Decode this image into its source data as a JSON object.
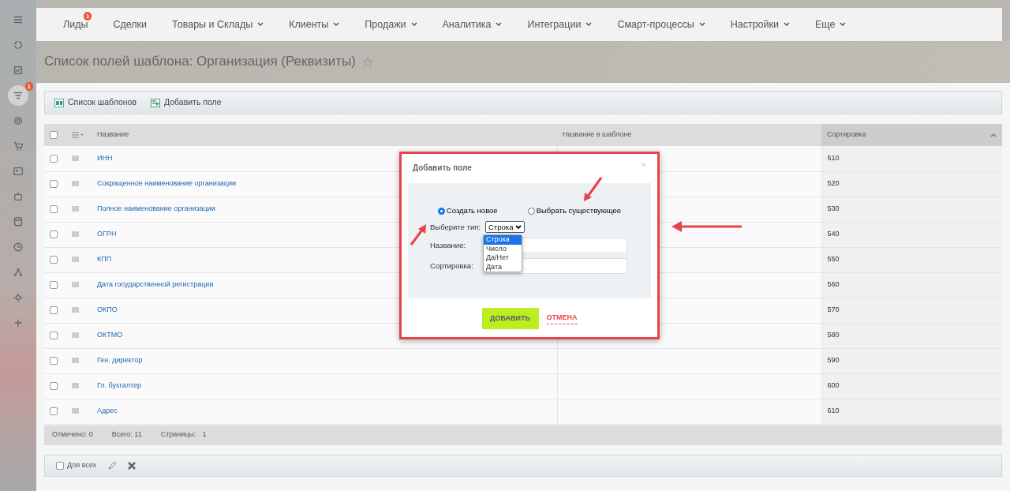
{
  "sidebar": {
    "items": [
      {
        "selected": false
      },
      {
        "selected": false
      },
      {
        "selected": false
      },
      {
        "selected": true,
        "badge": "1"
      },
      {
        "selected": false
      },
      {
        "selected": false
      },
      {
        "selected": false
      },
      {
        "selected": false
      },
      {
        "selected": false
      },
      {
        "selected": false
      },
      {
        "selected": false
      },
      {
        "selected": false
      },
      {
        "selected": false
      }
    ]
  },
  "nav": [
    {
      "label": "Лиды",
      "badge": "1",
      "dropdown": false
    },
    {
      "label": "Сделки",
      "dropdown": false
    },
    {
      "label": "Товары и Склады",
      "dropdown": true
    },
    {
      "label": "Клиенты",
      "dropdown": true
    },
    {
      "label": "Продажи",
      "dropdown": true
    },
    {
      "label": "Аналитика",
      "dropdown": true
    },
    {
      "label": "Интеграции",
      "dropdown": true
    },
    {
      "label": "Смарт-процессы",
      "dropdown": true
    },
    {
      "label": "Настройки",
      "dropdown": true
    },
    {
      "label": "Еще",
      "dropdown": true
    }
  ],
  "page_title": "Список полей шаблона: Организация (Реквизиты)",
  "favorite": false,
  "toolbar": [
    {
      "label": "Список шаблонов",
      "kind": "list"
    },
    {
      "label": "Добавить поле",
      "kind": "add"
    }
  ],
  "table": {
    "all_checked": false,
    "columns": [
      {
        "label": "Название",
        "sorted": false
      },
      {
        "label": "Название в шаблоне",
        "sorted": false
      },
      {
        "label": "Сортировка",
        "sorted": true
      }
    ],
    "rows": [
      {
        "name": "ИНН",
        "sort": "510",
        "checked": false
      },
      {
        "name": "Сокращенное наименование организации",
        "sort": "520",
        "checked": false
      },
      {
        "name": "Полное наименование организации",
        "sort": "530",
        "checked": false
      },
      {
        "name": "ОГРН",
        "sort": "540",
        "checked": false
      },
      {
        "name": "КПП",
        "sort": "550",
        "checked": false
      },
      {
        "name": "Дата государственной регистрации",
        "sort": "560",
        "checked": false
      },
      {
        "name": "ОКПО",
        "sort": "570",
        "checked": false
      },
      {
        "name": "ОКТМО",
        "sort": "580",
        "checked": false
      },
      {
        "name": "Ген. директор",
        "sort": "590",
        "checked": false
      },
      {
        "name": "Гл. бухгалтер",
        "sort": "600",
        "checked": false
      },
      {
        "name": "Адрес",
        "sort": "610",
        "checked": false
      }
    ]
  },
  "footer": {
    "marked": "Отмечено: 0",
    "total": "Всего: 11",
    "pages_label": "Страницы:",
    "page": "1"
  },
  "actions": {
    "for_all": {
      "label": "Для всех",
      "checked": false
    }
  },
  "dialog": {
    "title": "Добавить поле",
    "modes": [
      {
        "label": "Создать новое",
        "selected": true
      },
      {
        "label": "Выбрать существующее",
        "selected": false
      }
    ],
    "type_label": "Выберите тип:",
    "type_value": "Строка",
    "type_options": [
      {
        "label": "Строка",
        "selected": true
      },
      {
        "label": "Число",
        "selected": false
      },
      {
        "label": "Да/Нет",
        "selected": false
      },
      {
        "label": "Дата",
        "selected": false
      }
    ],
    "fields": [
      {
        "label": "Название:"
      },
      {
        "label": "Сортировка:"
      }
    ],
    "submit": "ДОБАВИТЬ",
    "cancel": "ОТМЕНА"
  }
}
